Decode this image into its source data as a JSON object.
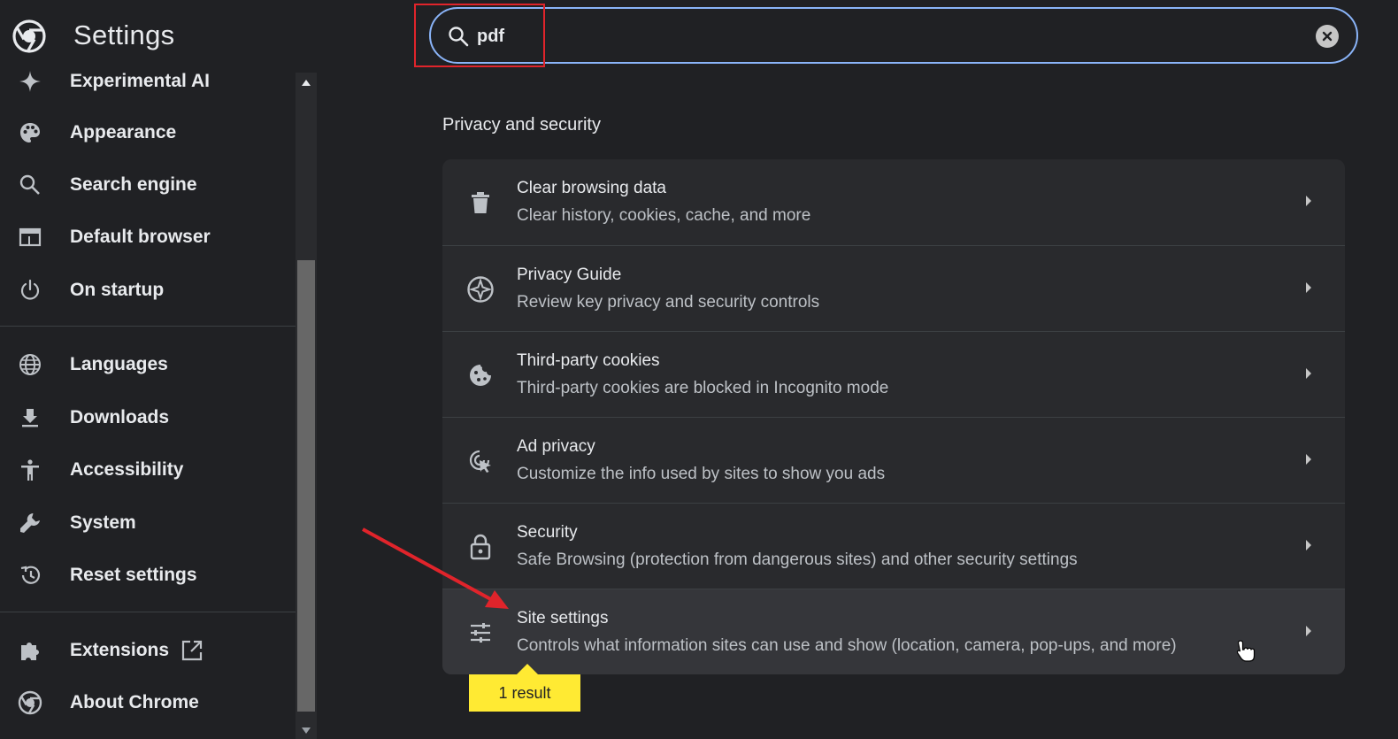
{
  "header": {
    "title": "Settings"
  },
  "search": {
    "value": "pdf",
    "placeholder": "Search settings"
  },
  "sidebar": {
    "items": [
      {
        "label": "Experimental AI",
        "icon": "sparkle-icon"
      },
      {
        "label": "Appearance",
        "icon": "palette-icon"
      },
      {
        "label": "Search engine",
        "icon": "search-icon"
      },
      {
        "label": "Default browser",
        "icon": "browser-window-icon"
      },
      {
        "label": "On startup",
        "icon": "power-icon"
      },
      {
        "label": "Languages",
        "icon": "globe-icon"
      },
      {
        "label": "Downloads",
        "icon": "download-icon"
      },
      {
        "label": "Accessibility",
        "icon": "accessibility-icon"
      },
      {
        "label": "System",
        "icon": "wrench-icon"
      },
      {
        "label": "Reset settings",
        "icon": "history-icon"
      },
      {
        "label": "Extensions",
        "icon": "puzzle-icon"
      },
      {
        "label": "About Chrome",
        "icon": "chrome-icon"
      }
    ]
  },
  "main": {
    "section_title": "Privacy and security",
    "rows": [
      {
        "title": "Clear browsing data",
        "subtitle": "Clear history, cookies, cache, and more",
        "icon": "trash-icon"
      },
      {
        "title": "Privacy Guide",
        "subtitle": "Review key privacy and security controls",
        "icon": "compass-icon"
      },
      {
        "title": "Third-party cookies",
        "subtitle": "Third-party cookies are blocked in Incognito mode",
        "icon": "cookie-icon"
      },
      {
        "title": "Ad privacy",
        "subtitle": "Customize the info used by sites to show you ads",
        "icon": "ad-privacy-icon"
      },
      {
        "title": "Security",
        "subtitle": "Safe Browsing (protection from dangerous sites) and other security settings",
        "icon": "lock-icon"
      },
      {
        "title": "Site settings",
        "subtitle": "Controls what information sites can use and show (location, camera, pop-ups, and more)",
        "icon": "sliders-icon"
      }
    ],
    "result_bubble": "1 result"
  },
  "colors": {
    "background": "#202124",
    "card": "#292a2d",
    "accent": "#8ab4f8",
    "annotation_red": "#e0242b",
    "bubble_yellow": "#ffea33"
  }
}
